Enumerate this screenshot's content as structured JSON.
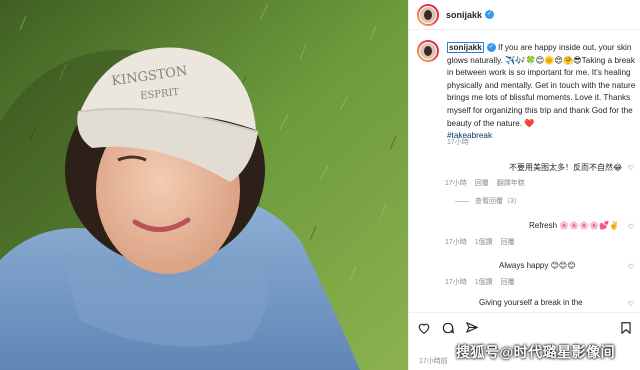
{
  "post": {
    "username": "sonijakk",
    "caption_user": "sonijakk",
    "caption_text": " If you are happy inside out, your skin glows naturally. ✈️🎶🍀😊🌞😍🤗😎Taking a break in between work is so important for me. It's healing physically and mentally. Get in touch with the nature brings me lots of blissful moments. Love it. Thanks myself for organizing this trip and thank God for the beauty of the nature. ❤️",
    "hashtag": "#takeabreak",
    "caption_time": "17小時"
  },
  "comments": [
    {
      "text": "不要用美图太多！反而不自然😂",
      "time": "17小時",
      "actions": [
        "回覆",
        "翻譯年糕"
      ]
    },
    {
      "view_replies": "查看回覆（3）"
    },
    {
      "text": "Refresh 🌸🌸🌸🌸💕✌️",
      "time": "17小時",
      "actions": [
        "1個讚",
        "回覆"
      ]
    },
    {
      "text": "Always happy 😊😊😊",
      "time": "17小時",
      "actions": [
        "1個讚",
        "回覆"
      ]
    },
    {
      "text": "Giving yourself a break in the",
      "partial": true
    }
  ],
  "footer": {
    "time": "17小時前"
  },
  "watermark": "搜狐号@时代璐星影像间",
  "photo": {
    "cap_text_1": "KINGSTON",
    "cap_text_2": "ESPRIT"
  },
  "colors": {
    "accent": "#3897f0",
    "hashtag": "#00376b"
  }
}
